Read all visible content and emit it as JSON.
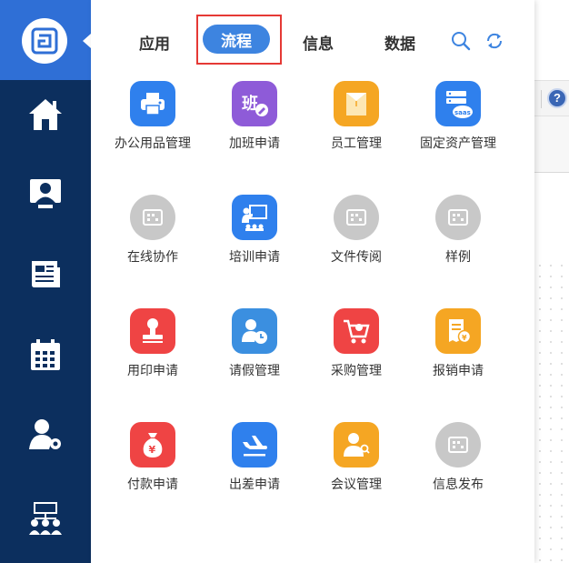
{
  "tabs": [
    {
      "label": "应用"
    },
    {
      "label": "流程"
    },
    {
      "label": "信息"
    },
    {
      "label": "数据"
    }
  ],
  "active_tab": "流程",
  "toolbar_icons": [
    "search-icon",
    "refresh-icon"
  ],
  "sidebar_icons": [
    "home-icon",
    "monitor-user-icon",
    "news-icon",
    "calendar-icon",
    "user-settings-icon",
    "org-chart-icon"
  ],
  "background_help_label": "?",
  "apps": [
    {
      "label": "办公用品管理",
      "icon": "printer-icon",
      "color": "#2f80ed"
    },
    {
      "label": "加班申请",
      "icon": "overtime-icon",
      "color": "#8e5bd8",
      "glyph": "班"
    },
    {
      "label": "员工管理",
      "icon": "folder-icon",
      "color": "#f5a623"
    },
    {
      "label": "固定资产管理",
      "icon": "saas-server-icon",
      "color": "#2f80ed",
      "glyph": "saas"
    },
    {
      "label": "在线协作",
      "icon": "placeholder-icon",
      "color": "#c8c8c8"
    },
    {
      "label": "培训申请",
      "icon": "training-icon",
      "color": "#2f80ed"
    },
    {
      "label": "文件传阅",
      "icon": "placeholder-icon",
      "color": "#c8c8c8"
    },
    {
      "label": "样例",
      "icon": "placeholder-icon",
      "color": "#c8c8c8"
    },
    {
      "label": "用印申请",
      "icon": "stamp-icon",
      "color": "#ef4444"
    },
    {
      "label": "请假管理",
      "icon": "leave-clock-icon",
      "color": "#3b8fe0"
    },
    {
      "label": "采购管理",
      "icon": "shopping-cart-icon",
      "color": "#ef4444"
    },
    {
      "label": "报销申请",
      "icon": "receipt-icon",
      "color": "#f5a623",
      "glyph": "¥"
    },
    {
      "label": "付款申请",
      "icon": "money-bag-icon",
      "color": "#ef4444",
      "glyph": "¥"
    },
    {
      "label": "出差申请",
      "icon": "airplane-icon",
      "color": "#2f80ed"
    },
    {
      "label": "会议管理",
      "icon": "meeting-icon",
      "color": "#f5a623"
    },
    {
      "label": "信息发布",
      "icon": "placeholder-icon",
      "color": "#c8c8c8"
    }
  ],
  "colors": {
    "sidebar": "#0c2f5e",
    "logo_cell": "#2f6fd6",
    "active_tab": "#3d84e0",
    "highlight": "#e53935"
  }
}
